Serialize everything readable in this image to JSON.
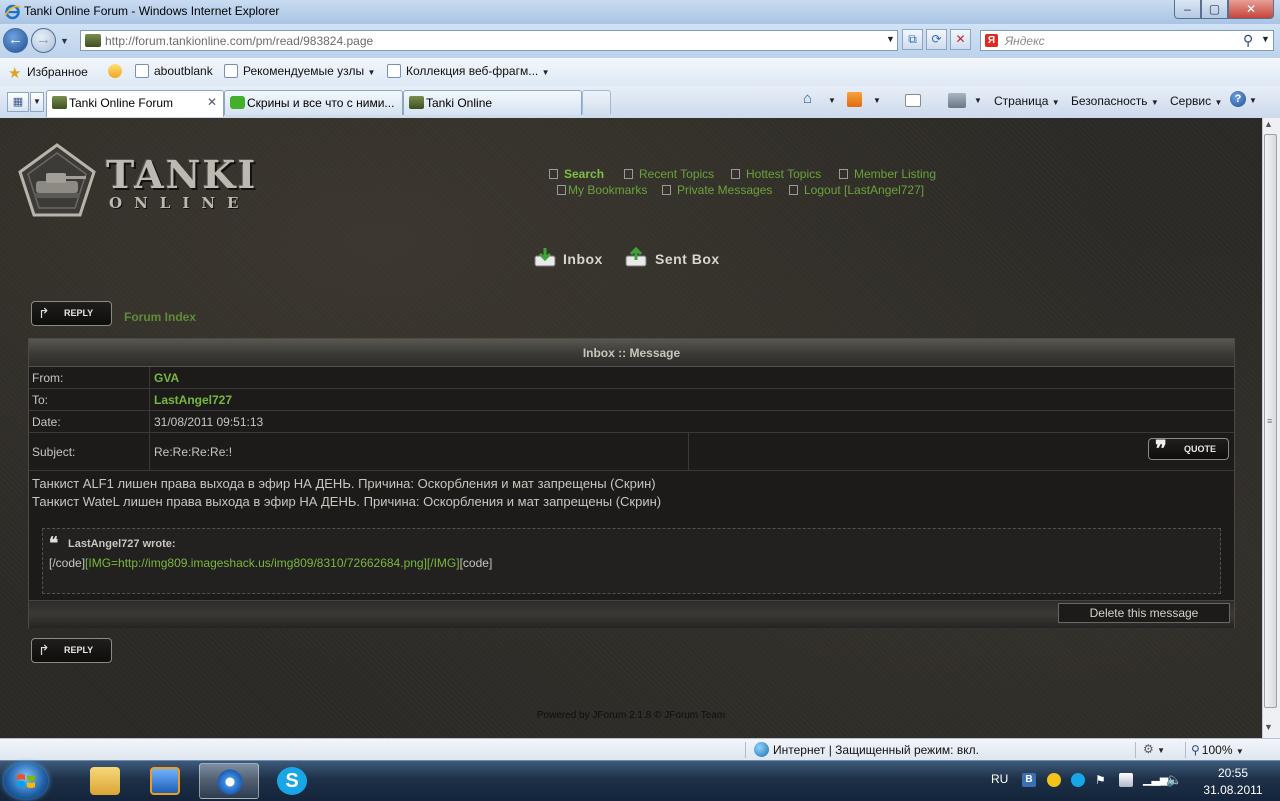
{
  "window": {
    "title": "Tanki Online Forum - Windows Internet Explorer",
    "min_glyph": "–",
    "max_glyph": "▢",
    "close_glyph": "✕"
  },
  "address_bar": {
    "url": "http://forum.tankionline.com/pm/read/983824.page",
    "back_glyph": "←",
    "forward_glyph": "→",
    "dropdown_glyph": "▼",
    "refresh_glyph": "⟳",
    "stop_glyph": "✕",
    "compat_glyph": "⧉"
  },
  "search": {
    "placeholder": "Яндекс",
    "logo_letter": "Я",
    "icon_glyph": "⚲"
  },
  "favorites_bar": {
    "favorites_label": "Избранное",
    "items": [
      "aboutblank",
      "Рекомендуемые узлы",
      "Коллекция веб-фрагм..."
    ]
  },
  "tabs": [
    {
      "label": "Tanki Online Forum",
      "active": true
    },
    {
      "label": "Скрины и все что с ними...",
      "active": false
    },
    {
      "label": "Tanki Online",
      "active": false
    }
  ],
  "tab_close_glyph": "✕",
  "command_bar": {
    "page_label": "Страница",
    "safety_label": "Безопасность",
    "tools_label": "Сервис",
    "help_glyph": "?"
  },
  "forum": {
    "logo_line1": "TANKI",
    "logo_line2": "ONLINE",
    "top_links": {
      "search": "Search",
      "recent_topics": "Recent Topics",
      "hottest_topics": "Hottest Topics",
      "member_listing": "Member Listing",
      "my_bookmarks": "My Bookmarks",
      "private_messages": "Private Messages",
      "logout": "Logout [LastAngel727]"
    },
    "inbox_label": "Inbox",
    "sent_box_label": "Sent Box",
    "reply_label": "REPLY",
    "forum_index_label": "Forum Index",
    "message": {
      "header": "Inbox :: Message",
      "from_label": "From:",
      "from_value": "GVA",
      "to_label": "To:",
      "to_value": "LastAngel727",
      "date_label": "Date:",
      "date_value": "31/08/2011 09:51:13",
      "subject_label": "Subject:",
      "subject_value": "Re:Re:Re:Re:!",
      "quote_label": "QUOTE",
      "body_lines": [
        "Танкист ALF1 лишен права выхода в эфир НА ДЕНЬ. Причина: Оскорбления и мат запрещены (Скрин)",
        "Танкист WateL лишен права выхода в эфир НА ДЕНЬ. Причина: Оскорбления и мат запрещены (Скрин)"
      ],
      "quote_author": "LastAngel727 wrote:",
      "quote_text_part1": "[/code]",
      "quote_text_part2": "[IMG=http://img809.imageshack.us/img809/8310/72662684.png][/IMG]",
      "quote_text_part3": "[code]",
      "delete_label": "Delete this message"
    },
    "powered_by": "Powered by JForum 2.1.8 © JForum Team"
  },
  "status_bar": {
    "zone_text": "Интернет | Защищенный режим: вкл.",
    "zoom": "100%"
  },
  "taskbar": {
    "language": "RU",
    "time": "20:55",
    "date": "31.08.2011"
  }
}
